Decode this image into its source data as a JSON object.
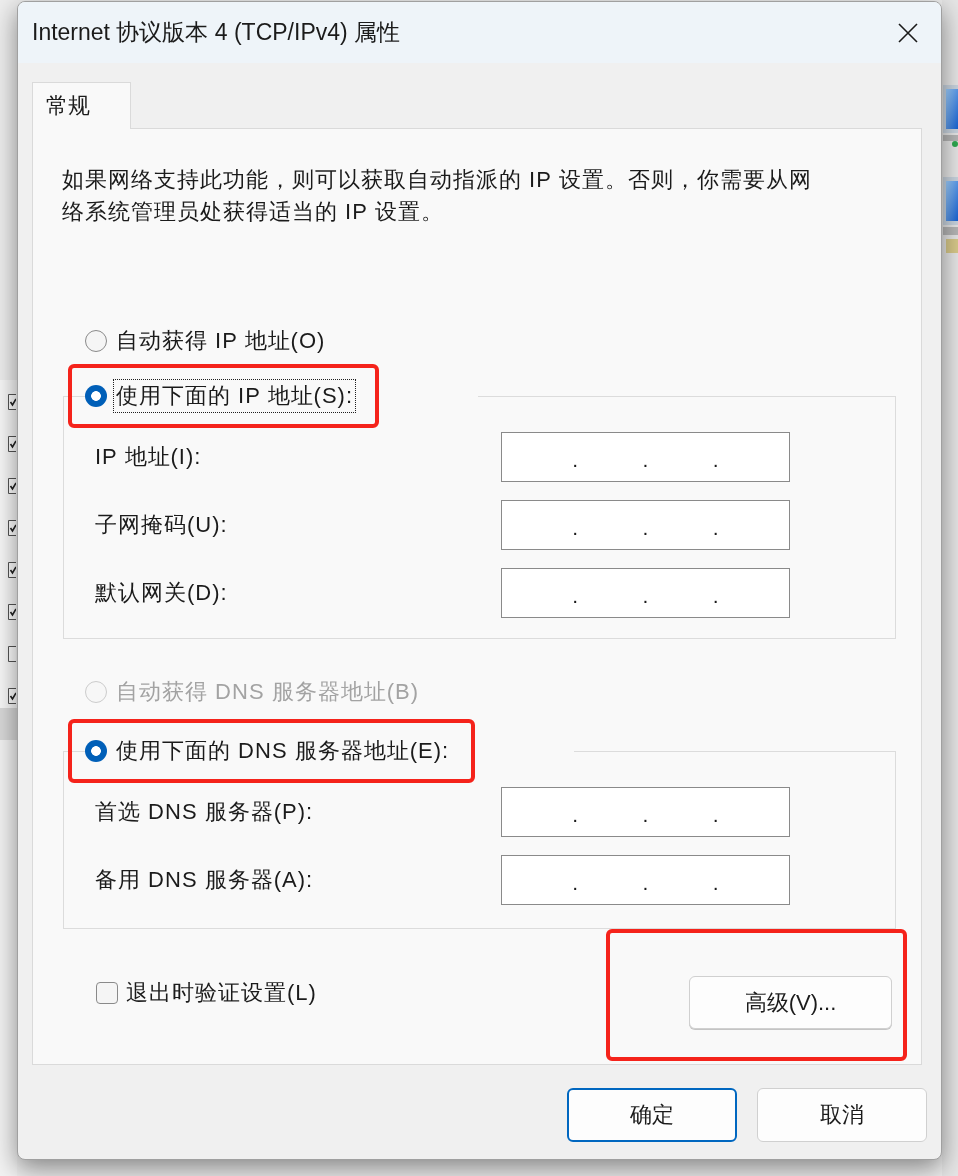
{
  "background_window": {
    "checkboxes": [
      {
        "checked": true
      },
      {
        "checked": true
      },
      {
        "checked": true
      },
      {
        "checked": true
      },
      {
        "checked": true
      },
      {
        "checked": true
      },
      {
        "checked": false
      },
      {
        "checked": true
      }
    ]
  },
  "dialog": {
    "title": "Internet 协议版本 4 (TCP/IPv4) 属性",
    "tabs": [
      {
        "label": "常规",
        "selected": true
      }
    ],
    "description": "如果网络支持此功能，则可以获取自动指派的 IP 设置。否则，你需要从网络系统管理员处获得适当的 IP 设置。",
    "ip_section": {
      "options": [
        {
          "label": "自动获得 IP 地址(O)",
          "selected": false,
          "disabled": false,
          "focused": false,
          "highlighted": false
        },
        {
          "label": "使用下面的 IP 地址(S):",
          "selected": true,
          "disabled": false,
          "focused": true,
          "highlighted": true
        }
      ],
      "fields": [
        {
          "label": "IP 地址(I):",
          "separators": [
            ".",
            ".",
            "."
          ]
        },
        {
          "label": "子网掩码(U):",
          "separators": [
            ".",
            ".",
            "."
          ]
        },
        {
          "label": "默认网关(D):",
          "separators": [
            ".",
            ".",
            "."
          ]
        }
      ]
    },
    "dns_section": {
      "options": [
        {
          "label": "自动获得 DNS 服务器地址(B)",
          "selected": false,
          "disabled": true,
          "focused": false,
          "highlighted": false
        },
        {
          "label": "使用下面的 DNS 服务器地址(E):",
          "selected": true,
          "disabled": false,
          "focused": false,
          "highlighted": true
        }
      ],
      "fields": [
        {
          "label": "首选 DNS 服务器(P):",
          "separators": [
            ".",
            ".",
            "."
          ]
        },
        {
          "label": "备用 DNS 服务器(A):",
          "separators": [
            ".",
            ".",
            "."
          ]
        }
      ]
    },
    "validate_on_exit": {
      "label": "退出时验证设置(L)",
      "checked": false
    },
    "advanced_button": {
      "label": "高级(V)...",
      "highlighted": true
    },
    "buttons": [
      {
        "label": "确定",
        "default": true
      },
      {
        "label": "取消",
        "default": false
      }
    ]
  }
}
